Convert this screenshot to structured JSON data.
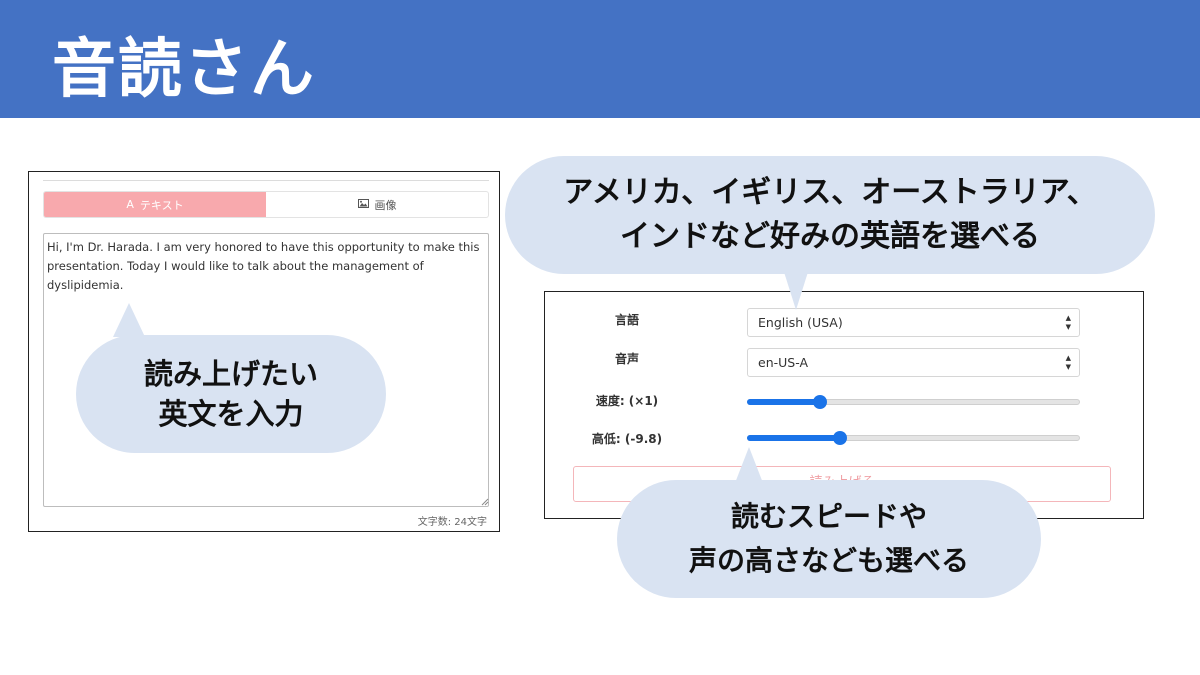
{
  "header": {
    "title": "音読さん"
  },
  "left_panel": {
    "tabs": [
      {
        "label": "テキスト",
        "icon": "font-icon",
        "active": true
      },
      {
        "label": "画像",
        "icon": "image-icon",
        "active": false
      }
    ],
    "textarea": {
      "value": "Hi, I'm Dr. Harada. I am very honored to have this opportunity to make this presentation. Today I would like to talk about the management of dyslipidemia."
    },
    "char_count": "文字数: 24文字"
  },
  "right_panel": {
    "language": {
      "label": "言語",
      "value": "English (USA)"
    },
    "voice": {
      "label": "音声",
      "value": "en-US-A"
    },
    "speed": {
      "label": "速度: (×1)",
      "fraction": 0.22
    },
    "pitch": {
      "label": "高低: (-9.8)",
      "fraction": 0.28
    },
    "read_button": "読み上げる"
  },
  "bubbles": {
    "input": {
      "line1": "読み上げたい",
      "line2": "英文を入力"
    },
    "language": {
      "line1": "アメリカ、イギリス、オーストラリア、",
      "line2": "インドなど好みの英語を選べる"
    },
    "speed": {
      "line1": "読むスピードや",
      "line2": "声の高さなども選べる"
    }
  },
  "colors": {
    "header": "#4472c4",
    "bubble": "#d9e3f2",
    "active_tab": "#f8a9ad",
    "slider": "#1a73e8"
  }
}
